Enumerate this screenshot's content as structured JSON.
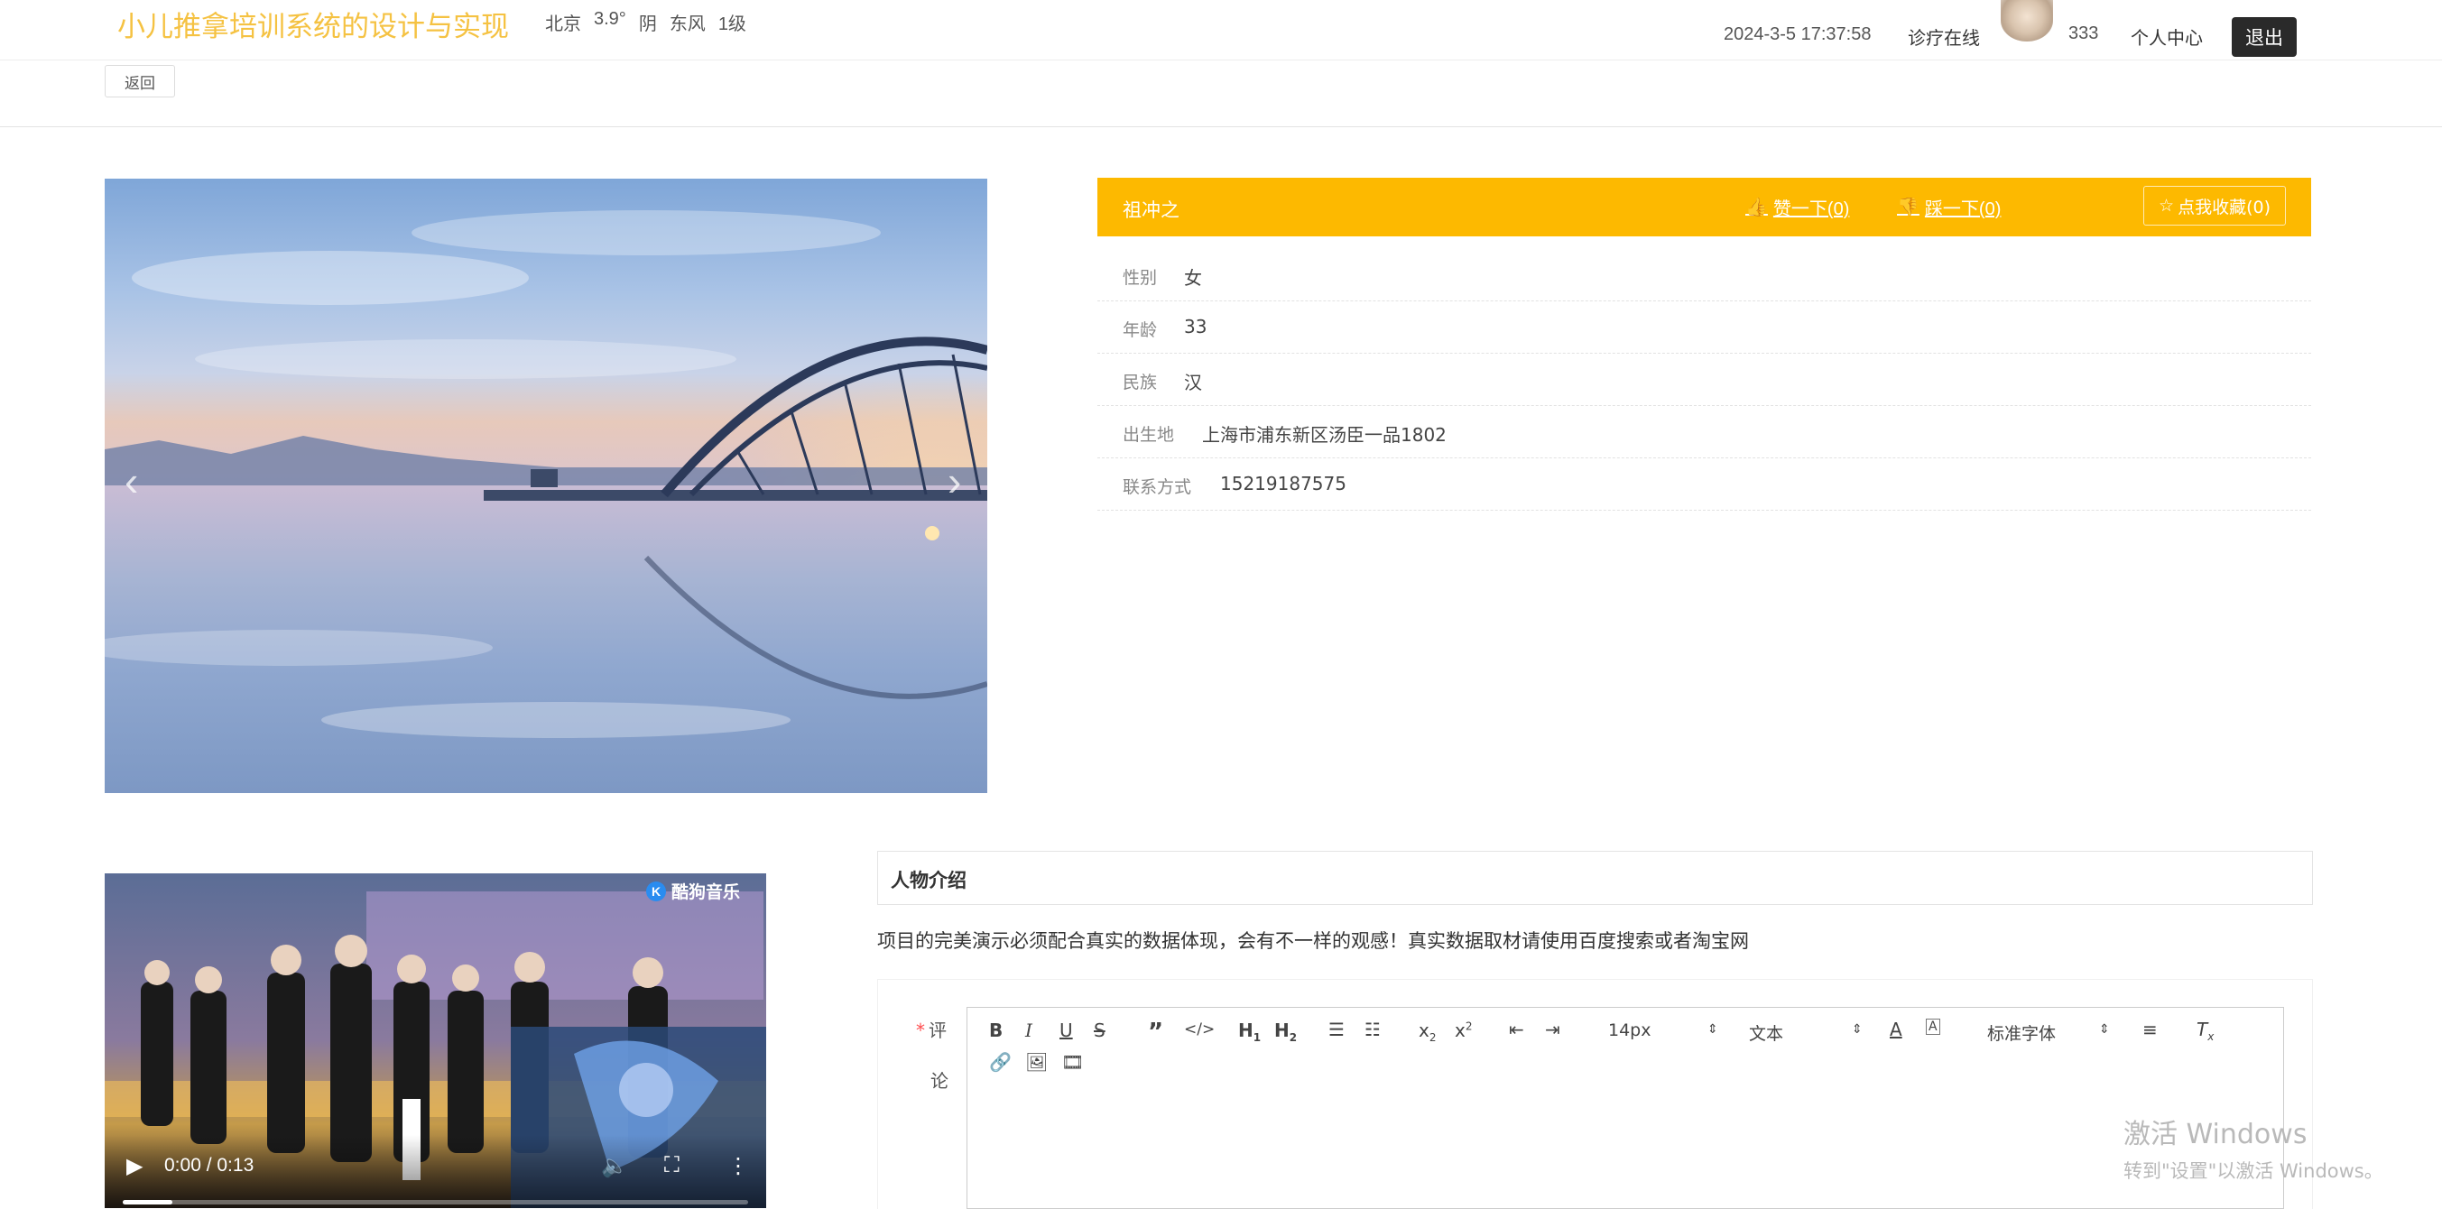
{
  "header": {
    "title": "小儿推拿培训系统的设计与实现",
    "weather": {
      "city": "北京",
      "temperature": "3.9°",
      "condition": "阴",
      "wind": "东风",
      "level": "1级"
    },
    "datetime": "2024-3-5 17:37:58",
    "nav_clinic": "诊疗在线",
    "username": "333",
    "nav_profile": "个人中心",
    "logout": "退出"
  },
  "back_button": "返回",
  "carousel": {
    "prev_icon": "‹",
    "next_icon": "›"
  },
  "info": {
    "name": "祖冲之",
    "like": "赞一下(0)",
    "dislike": "踩一下(0)",
    "favorite": "点我收藏(0)",
    "rows": [
      {
        "label": "性别",
        "value": "女"
      },
      {
        "label": "年龄",
        "value": "33"
      },
      {
        "label": "民族",
        "value": "汉"
      },
      {
        "label": "出生地",
        "value": "上海市浦东新区汤臣一品1802"
      },
      {
        "label": "联系方式",
        "value": "15219187575"
      }
    ]
  },
  "video": {
    "time": "0:00 / 0:13",
    "watermark": "酷狗音乐",
    "progress": 0.08
  },
  "intro": {
    "title": "人物介绍",
    "text": "项目的完美演示必须配合真实的数据体现，会有不一样的观感！真实数据取材请使用百度搜索或者淘宝网"
  },
  "comment": {
    "label_1": "评",
    "label_2": "论",
    "toolbar": {
      "font_size": "14px",
      "format": "文本",
      "font_family": "标准字体"
    }
  },
  "os_watermark": {
    "line1": "激活 Windows",
    "line2": "转到\"设置\"以激活 Windows。"
  },
  "colors": {
    "brand": "#f5c242",
    "info_header": "#fdb900",
    "logout_bg": "#2a2a2a"
  }
}
